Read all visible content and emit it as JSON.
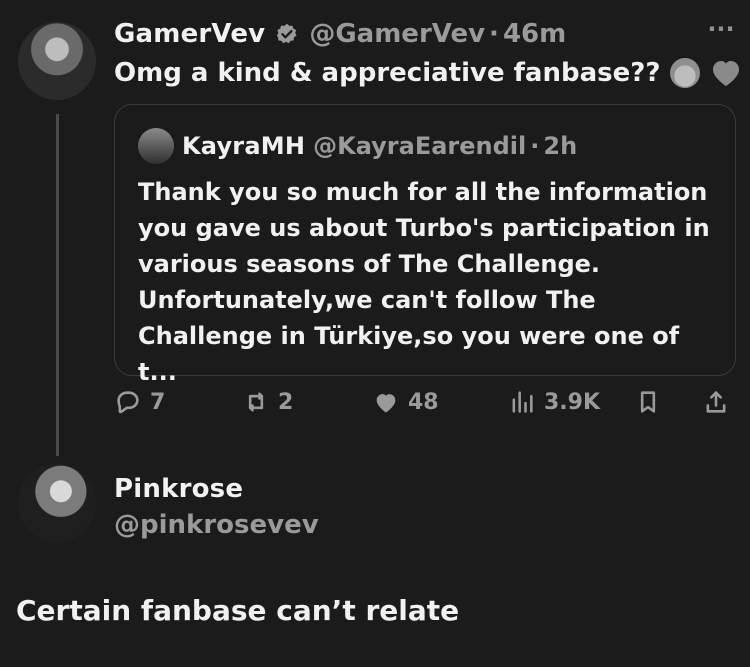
{
  "post": {
    "author_name": "GamerVev",
    "handle": "@GamerVev",
    "dot": "·",
    "time": "46m",
    "text": "Omg a kind & appreciative fanbase??",
    "more": "···",
    "quote": {
      "author_name": "KayraMH",
      "handle": "@KayraEarendil",
      "dot": "·",
      "time": "2h",
      "lines": [
        "Thank you so much for all the information",
        "you gave us about Turbo's participation in",
        "various seasons of The Challenge.",
        "Unfortunately,we can't follow The",
        "Challenge in Türkiye,so you were one of t..."
      ]
    },
    "actions": {
      "replies": "7",
      "reposts": "2",
      "likes": "48",
      "views": "3.9K"
    }
  },
  "reply": {
    "author_name": "Pinkrose",
    "handle": "@pinkrosevev",
    "text": "Certain fanbase can’t relate"
  },
  "icons": {
    "verified": "verified-badge-icon",
    "reply": "reply-icon",
    "repost": "repost-icon",
    "like": "heart-icon",
    "views": "views-icon",
    "bookmark": "bookmark-icon",
    "share": "share-icon"
  }
}
